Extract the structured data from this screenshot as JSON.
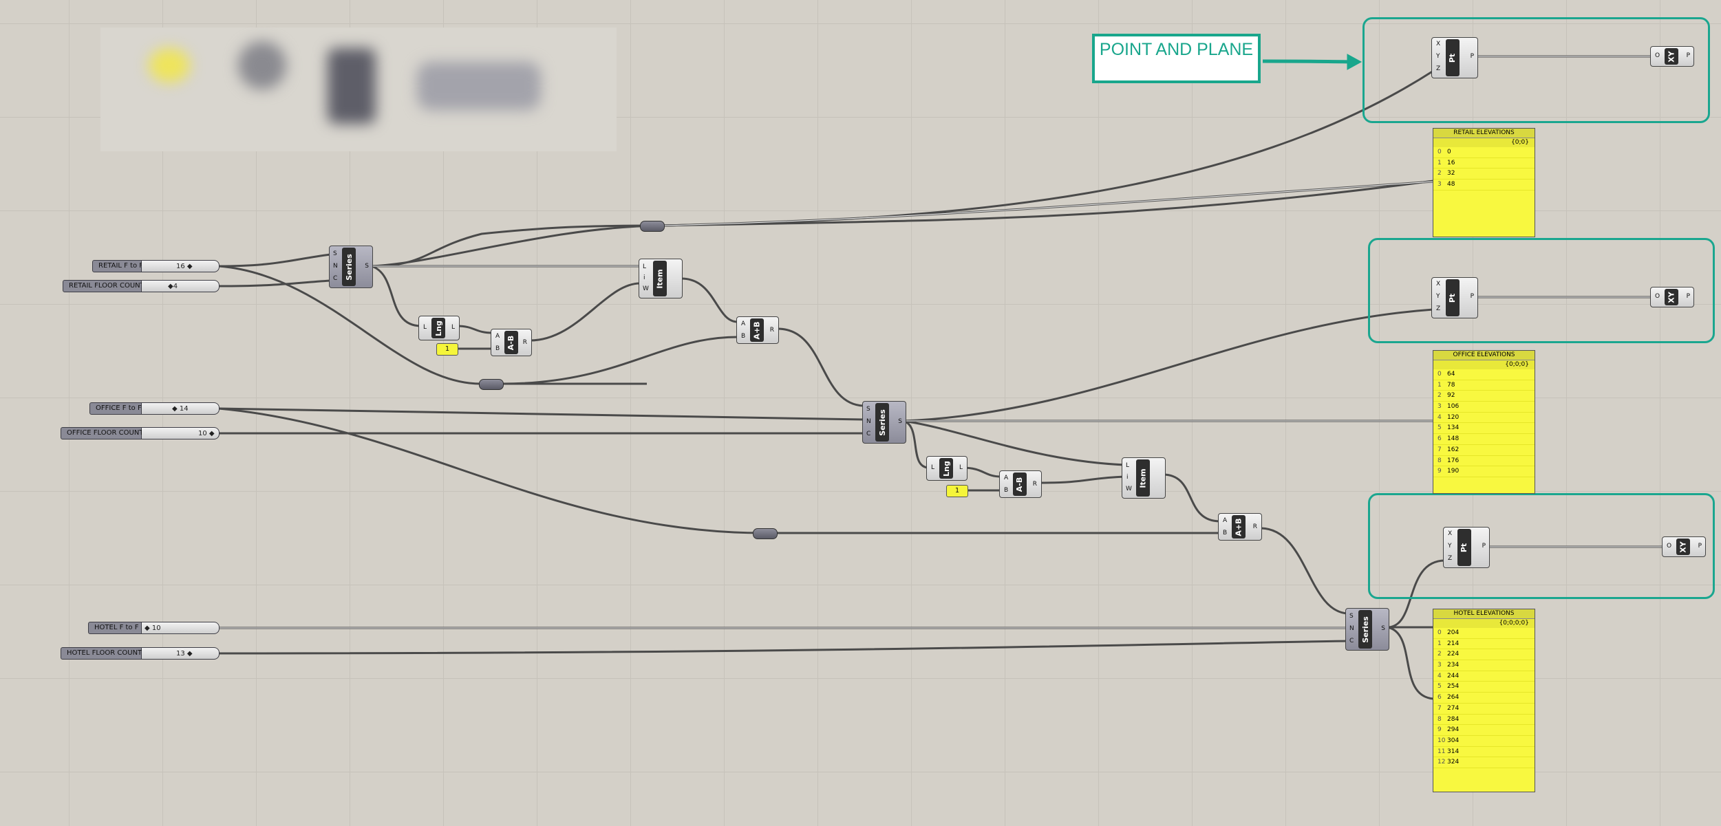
{
  "sliders": {
    "retail_ftf": {
      "label": "RETAIL F to F",
      "value": "16 ◆"
    },
    "retail_count": {
      "label": "RETAIL FLOOR COUNT",
      "value": "◆4"
    },
    "office_ftf": {
      "label": "OFFICE F to F",
      "value": "◆ 14"
    },
    "office_count": {
      "label": "OFFICE FLOOR COUNT",
      "value": "10 ◆"
    },
    "hotel_ftf": {
      "label": "HOTEL F to F",
      "value": "◆ 10"
    },
    "hotel_count": {
      "label": "HOTEL FLOOR COUNT",
      "value": "13 ◆"
    }
  },
  "components": {
    "series": "Series",
    "item": "Item",
    "lng": "Lng",
    "minus": "A-B",
    "plus": "A+B",
    "pt": "Pt",
    "xy": "XY",
    "ports": {
      "S": "S",
      "N": "N",
      "C": "C",
      "L": "L",
      "i": "i",
      "W": "W",
      "A": "A",
      "B": "B",
      "R": "R",
      "X": "X",
      "Y": "Y",
      "Z": "Z",
      "O": "O",
      "P": "P"
    },
    "one": "1"
  },
  "panels": {
    "retail": {
      "title": "RETAIL ELEVATIONS",
      "path": "{0;0}",
      "rows": [
        [
          "0",
          "0"
        ],
        [
          "1",
          "16"
        ],
        [
          "2",
          "32"
        ],
        [
          "3",
          "48"
        ]
      ]
    },
    "office": {
      "title": "OFFICE ELEVATIONS",
      "path": "{0;0;0}",
      "rows": [
        [
          "0",
          "64"
        ],
        [
          "1",
          "78"
        ],
        [
          "2",
          "92"
        ],
        [
          "3",
          "106"
        ],
        [
          "4",
          "120"
        ],
        [
          "5",
          "134"
        ],
        [
          "6",
          "148"
        ],
        [
          "7",
          "162"
        ],
        [
          "8",
          "176"
        ],
        [
          "9",
          "190"
        ]
      ]
    },
    "hotel": {
      "title": "HOTEL ELEVATIONS",
      "path": "{0;0;0;0}",
      "rows": [
        [
          "0",
          "204"
        ],
        [
          "1",
          "214"
        ],
        [
          "2",
          "224"
        ],
        [
          "3",
          "234"
        ],
        [
          "4",
          "244"
        ],
        [
          "5",
          "254"
        ],
        [
          "6",
          "264"
        ],
        [
          "7",
          "274"
        ],
        [
          "8",
          "284"
        ],
        [
          "9",
          "294"
        ],
        [
          "10",
          "304"
        ],
        [
          "11",
          "314"
        ],
        [
          "12",
          "324"
        ]
      ]
    }
  },
  "annotation": {
    "text": "POINT AND PLANE",
    "color": "#1aa68f"
  },
  "colors": {
    "canvas": "#d4d0c8",
    "panel": "#f8f840",
    "highlight": "#1aa68f"
  }
}
